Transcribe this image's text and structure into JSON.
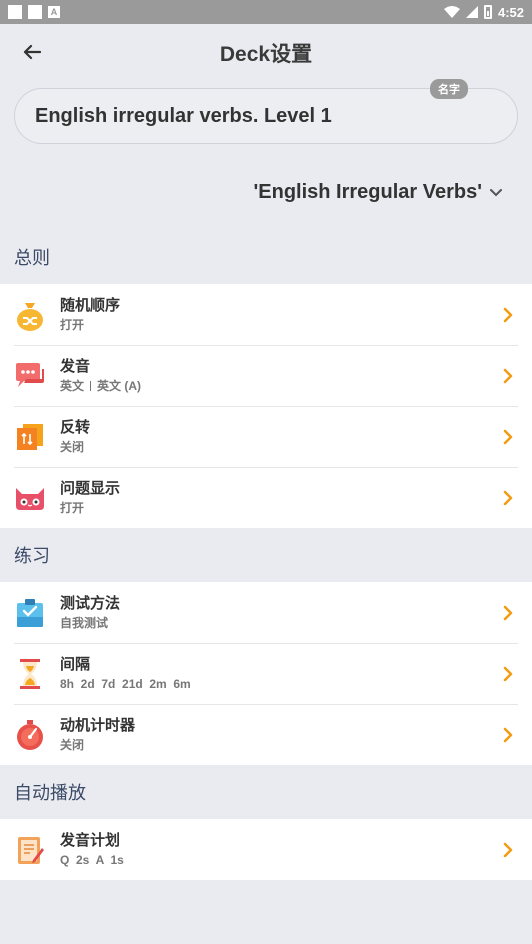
{
  "status_bar": {
    "time": "4:52"
  },
  "header": {
    "title": "Deck设置"
  },
  "name_field": {
    "value": "English irregular verbs. Level 1",
    "badge": "名字"
  },
  "deck_select": {
    "selected": "'English Irregular Verbs'"
  },
  "sections": {
    "general": {
      "label": "总则",
      "items": [
        {
          "title": "随机顺序",
          "sub": "打开"
        },
        {
          "title": "发音",
          "sub_a": "英文",
          "sub_b": "英文 (A)"
        },
        {
          "title": "反转",
          "sub": "关闭"
        },
        {
          "title": "问题显示",
          "sub": "打开"
        }
      ]
    },
    "practice": {
      "label": "练习",
      "items": [
        {
          "title": "测试方法",
          "sub": "自我测试"
        },
        {
          "title": "间隔",
          "sub": "8h  2d  7d  21d  2m  6m"
        },
        {
          "title": "动机计时器",
          "sub": "关闭"
        }
      ]
    },
    "autoplay": {
      "label": "自动播放",
      "items": [
        {
          "title": "发音计划",
          "sub": "Q  2s  A  1s"
        }
      ]
    }
  },
  "colors": {
    "accent": "#f39c12",
    "background": "#e9ebf0",
    "section_text": "#3b4a66"
  },
  "icons": [
    "back-arrow-icon",
    "chevron-down-icon",
    "shuffle-bag-icon",
    "chat-bubble-icon",
    "flip-cards-icon",
    "cat-face-icon",
    "clipboard-check-icon",
    "hourglass-icon",
    "timer-icon",
    "notepad-pen-icon",
    "chevron-right-icon"
  ]
}
